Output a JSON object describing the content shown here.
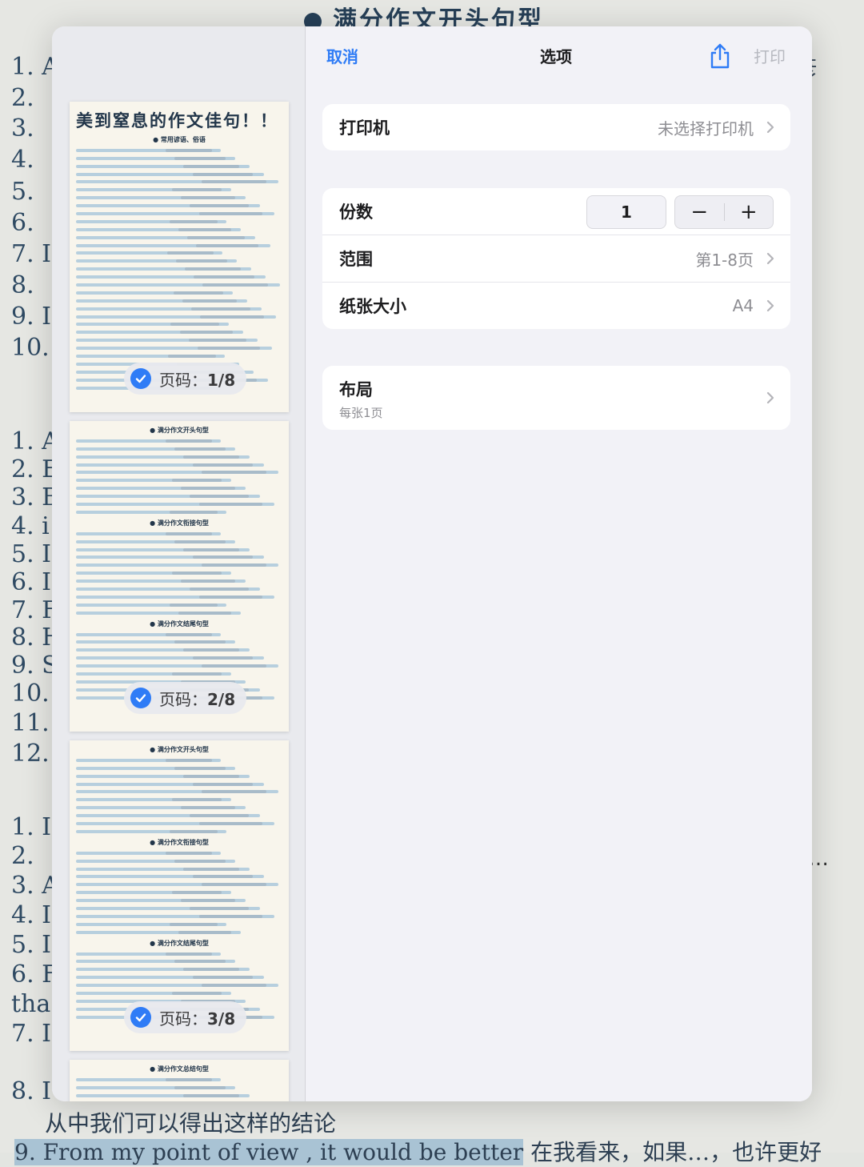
{
  "background": {
    "title": "满分作文开头句型",
    "side_char": "彥",
    "numbers_group1": [
      "1. A",
      "2.",
      "3.",
      "4.",
      "5.",
      "6.",
      "7. I",
      "8.",
      "9. I",
      "10."
    ],
    "numbers_group2": [
      "1. A",
      "2. E",
      "3. B",
      "4. i",
      "5. I",
      "6. I",
      "7. F",
      "8. H",
      "9. S",
      "10.",
      "11. I",
      "12."
    ],
    "numbers_group3": [
      "1. I",
      "2.",
      "3. A",
      "4. I",
      "5. I",
      "6. F",
      "tha",
      "7. I",
      "8. I"
    ],
    "ellipsis": "…",
    "bottom_line1": "从中我们可以得出这样的结论",
    "bottom_line2_highlight": "9. From my point of view , it would be better",
    "bottom_line2_rest": "在我看来，如果…，也许更好"
  },
  "dialog": {
    "cancel_label": "取消",
    "title": "选项",
    "share_icon": "share-icon",
    "print_label": "打印",
    "printer": {
      "label": "打印机",
      "value": "未选择打印机"
    },
    "copies": {
      "label": "份数",
      "value": "1",
      "minus": "−",
      "plus": "+"
    },
    "range": {
      "label": "范围",
      "value": "第1-8页"
    },
    "paper_size": {
      "label": "纸张大小",
      "value": "A4"
    },
    "layout": {
      "label": "布局",
      "subtitle": "每张1页"
    }
  },
  "thumbnails": [
    {
      "title": "美到窒息的作文佳句！！",
      "subtitle": "● 常用谚语、俗语",
      "badge_prefix": "页码：",
      "badge_page": "1/8",
      "selected": true
    },
    {
      "heading1": "● 满分作文开头句型",
      "heading2": "● 满分作文衔接句型",
      "heading3": "● 满分作文结尾句型",
      "badge_prefix": "页码：",
      "badge_page": "2/8",
      "selected": true
    },
    {
      "heading1": "● 满分作文开头句型",
      "heading2": "● 满分作文衔接句型",
      "heading3": "● 满分作文结尾句型",
      "badge_prefix": "页码：",
      "badge_page": "3/8",
      "selected": true
    },
    {
      "heading1": "● 满分作文总结句型"
    }
  ]
}
